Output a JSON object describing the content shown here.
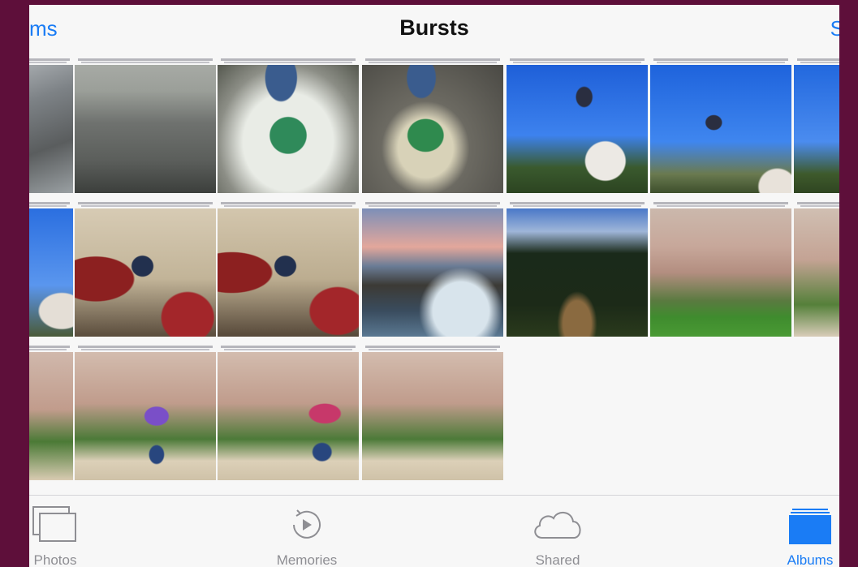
{
  "navbar": {
    "back_label": "ms",
    "title": "Bursts",
    "right_label": "S"
  },
  "grid": {
    "thumbnails": [
      {
        "row": 0,
        "col": 0,
        "subject": "water splash"
      },
      {
        "row": 0,
        "col": 1,
        "subject": "wet puddle road"
      },
      {
        "row": 0,
        "col": 2,
        "subject": "green boots splash"
      },
      {
        "row": 0,
        "col": 3,
        "subject": "green boots puddle"
      },
      {
        "row": 0,
        "col": 4,
        "subject": "baby thrown in air"
      },
      {
        "row": 0,
        "col": 5,
        "subject": "baby high in air"
      },
      {
        "row": 0,
        "col": 6,
        "subject": "baby in air"
      },
      {
        "row": 1,
        "col": 0,
        "subject": "man and sky"
      },
      {
        "row": 1,
        "col": 1,
        "subject": "boy with drums"
      },
      {
        "row": 1,
        "col": 2,
        "subject": "boy dancing with drums"
      },
      {
        "row": 1,
        "col": 3,
        "subject": "lighthouse coast"
      },
      {
        "row": 1,
        "col": 4,
        "subject": "hedge garden path"
      },
      {
        "row": 1,
        "col": 5,
        "subject": "mansion lawn"
      },
      {
        "row": 1,
        "col": 6,
        "subject": "mansion facade"
      },
      {
        "row": 2,
        "col": 0,
        "subject": "mansion facade"
      },
      {
        "row": 2,
        "col": 1,
        "subject": "umbrella walker"
      },
      {
        "row": 2,
        "col": 2,
        "subject": "umbrella walker"
      },
      {
        "row": 2,
        "col": 3,
        "subject": "mansion courtyard"
      }
    ]
  },
  "tabbar": {
    "tabs": [
      {
        "label": "Photos",
        "icon": "photos-icon",
        "active": false
      },
      {
        "label": "Memories",
        "icon": "memories-icon",
        "active": false
      },
      {
        "label": "Shared",
        "icon": "cloud-icon",
        "active": false
      },
      {
        "label": "Albums",
        "icon": "albums-icon",
        "active": true
      }
    ]
  },
  "colors": {
    "accent": "#1a7cf5",
    "background_outer": "#5e0f3a",
    "inactive_tab": "#8e8e93"
  }
}
